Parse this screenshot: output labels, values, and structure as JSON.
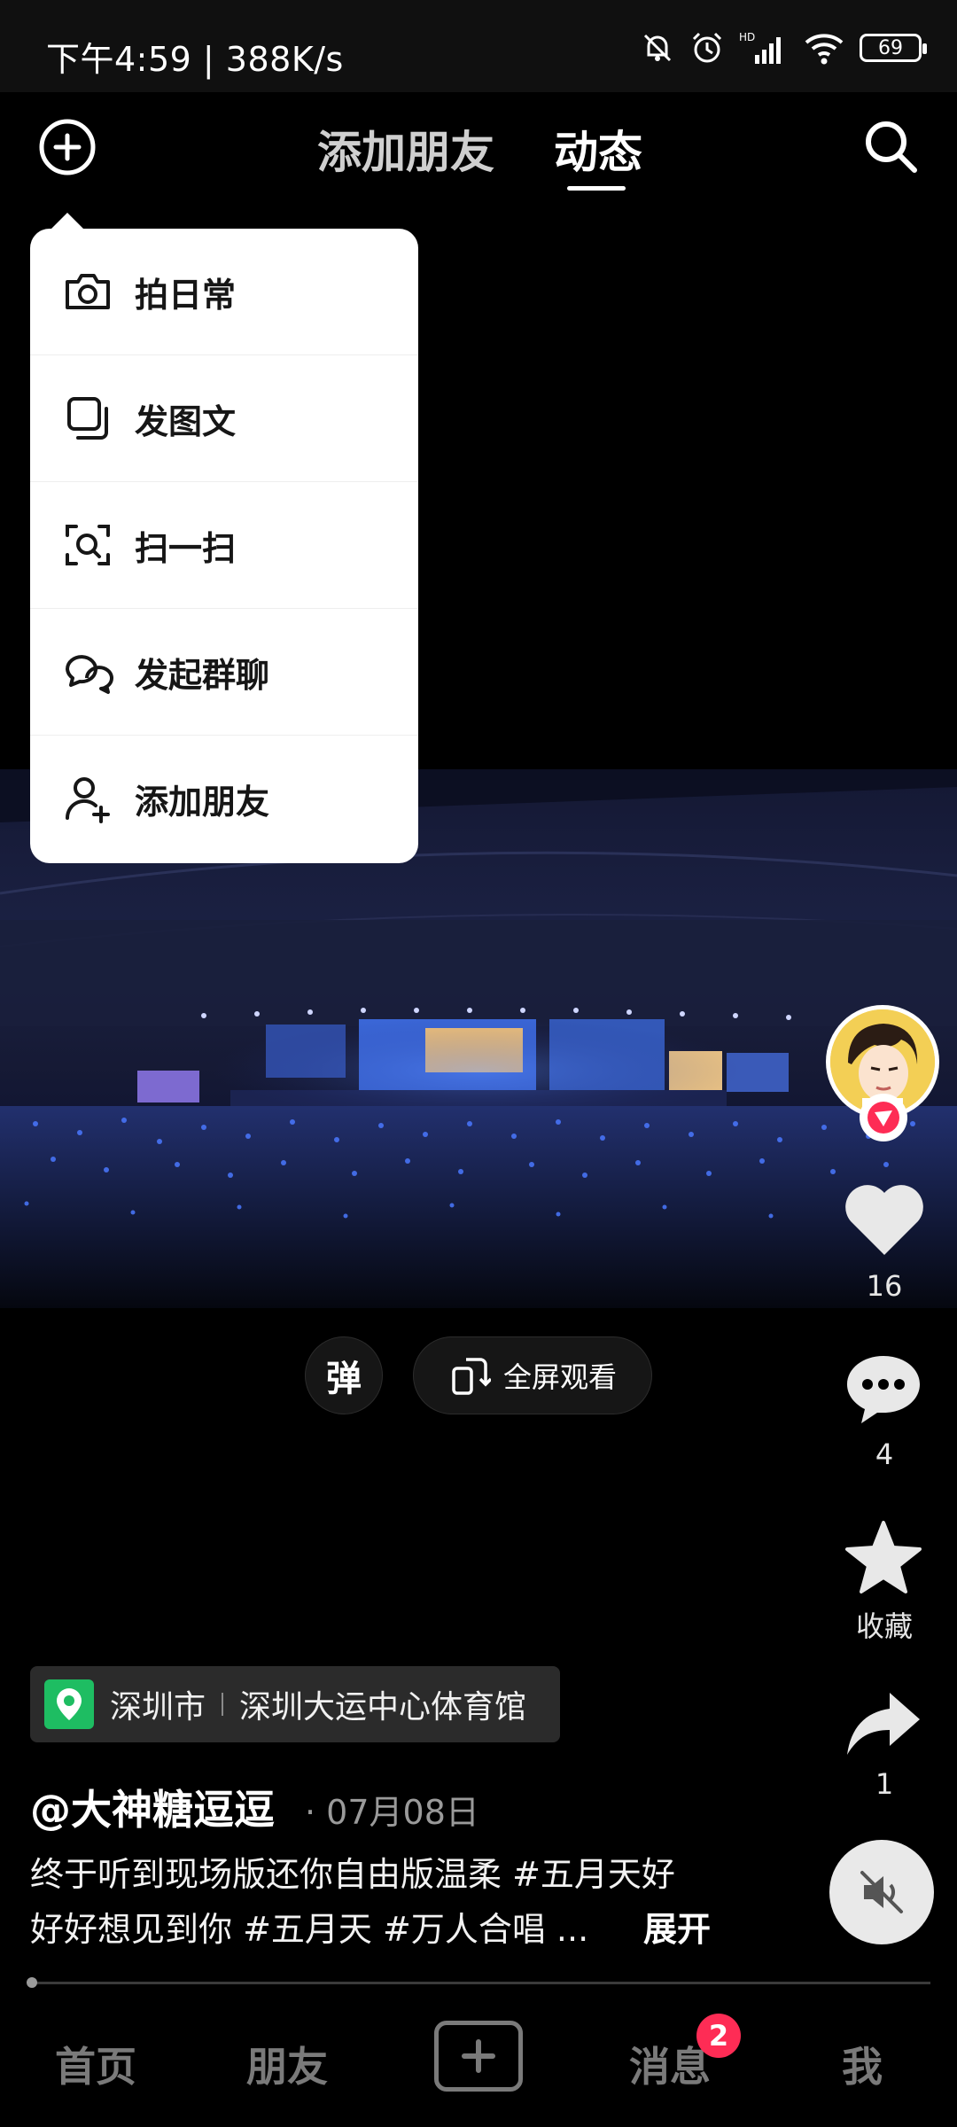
{
  "status_bar": {
    "time_speed": "下午4:59 | 388K/s",
    "battery": "69"
  },
  "top_nav": {
    "tabs": [
      {
        "label": "添加朋友"
      },
      {
        "label": "动态"
      }
    ]
  },
  "menu": {
    "items": [
      {
        "label": "拍日常",
        "icon": "camera-icon"
      },
      {
        "label": "发图文",
        "icon": "image-text-icon"
      },
      {
        "label": "扫一扫",
        "icon": "scan-icon"
      },
      {
        "label": "发起群聊",
        "icon": "group-chat-icon"
      },
      {
        "label": "添加朋友",
        "icon": "add-friend-icon"
      }
    ]
  },
  "actions": {
    "likes": "16",
    "comments": "4",
    "favorite_label": "收藏",
    "shares": "1"
  },
  "pills": {
    "danmaku": "弹",
    "fullscreen": "全屏观看"
  },
  "post": {
    "location_city": "深圳市",
    "location_place": "深圳大运中心体育馆",
    "author": "@大神糖逗逗",
    "date": "· 07月08日",
    "caption_line1": "终于听到现场版还你自由版温柔 #五月天好",
    "caption_line2": "好好想见到你 #五月天 #万人合唱 ...",
    "expand": "展开"
  },
  "bottom_nav": {
    "items": [
      {
        "label": "首页"
      },
      {
        "label": "朋友"
      },
      {
        "label": "消息"
      },
      {
        "label": "我"
      }
    ],
    "message_badge": "2"
  },
  "colors": {
    "badge": "#fe2c55",
    "location_icon": "#1ebd62"
  }
}
